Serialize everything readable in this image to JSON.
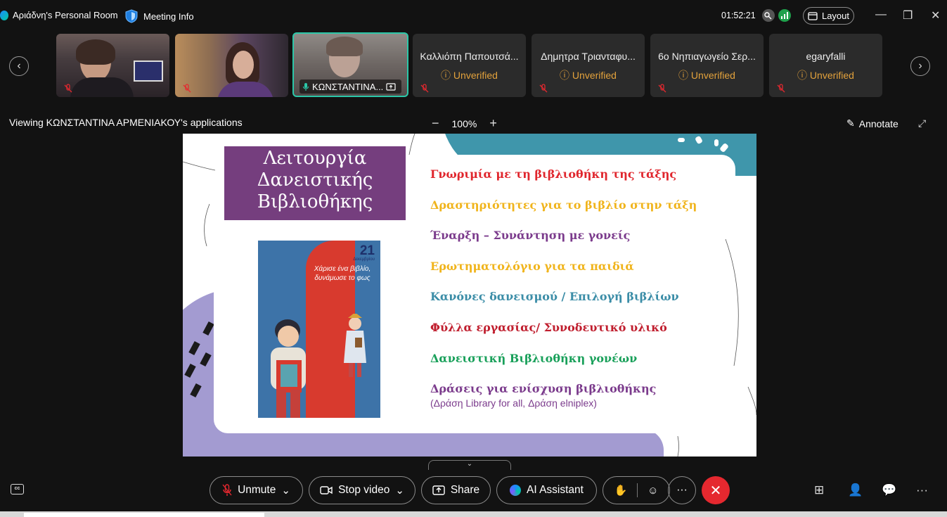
{
  "header": {
    "room_title": "Αριάδνη's Personal Room",
    "meeting_info": "Meeting Info",
    "time": "01:52:21",
    "layout_label": "Layout"
  },
  "participants": [
    {
      "name": "",
      "type": "video"
    },
    {
      "name": "",
      "type": "video"
    },
    {
      "name": "ΚΩΝΣΤΑΝΤΙΝΑ...",
      "type": "video",
      "active": true
    },
    {
      "name": "Καλλιόπη Παπουτσά...",
      "status": "Unverified"
    },
    {
      "name": "Δημητρα Τριανταφυ...",
      "status": "Unverified"
    },
    {
      "name": "6ο Νηπιαγωγείο Σερ...",
      "status": "Unverified"
    },
    {
      "name": "egaryfalli",
      "status": "Unverified"
    }
  ],
  "share_bar": {
    "viewing_text": "Viewing ΚΩΝΣΤΑΝΤΙΝΑ ΑΡΜΕΝΙΑΚΟΥ's applications",
    "zoom_out": "−",
    "zoom_level": "100%",
    "zoom_in": "+",
    "annotate": "Annotate"
  },
  "slide": {
    "title": "Λειτουργία Δανειστικής Βιβλιοθήκης",
    "book_number": "21",
    "book_subtitle": "Δεκεμβρίου",
    "book_text": "Χάρισε ένα βιβλίο, δυνάμωσε το φως",
    "items": [
      {
        "text": "Γνωριμία με τη βιβλιοθήκη της τάξης",
        "color": "#e0262d"
      },
      {
        "text": "Δραστηριότητες για το βιβλίο στην τάξη",
        "color": "#f0b41c"
      },
      {
        "text": "Έναρξη – Συνάντηση με γονείς",
        "color": "#7b3b8c"
      },
      {
        "text": "Ερωτηματολόγιο για τα παιδιά",
        "color": "#f0b41c"
      },
      {
        "text": "Κανόνες δανεισμού / Επιλογή βιβλίων",
        "color": "#3b8da7"
      },
      {
        "text": "Φύλλα εργασίας/ Συνοδευτικό υλικό",
        "color": "#c01e2e"
      },
      {
        "text": "Δανειστική Βιβλιοθήκη γονέων",
        "color": "#19a05a"
      },
      {
        "text": "Δράσεις για ενίσχυση βιβλιοθήκης",
        "color": "#7b3b8c"
      }
    ],
    "note": "(Δράση Library for all, Δράση elniplex)"
  },
  "controls": {
    "unmute": "Unmute",
    "stop_video": "Stop video",
    "share": "Share",
    "ai_assistant": "AI Assistant",
    "more": "···"
  },
  "colors": {
    "active_border": "#2bc7a8",
    "unverified": "#e3a23c",
    "leave": "#e5282f",
    "slide_purple": "#753e7e"
  }
}
